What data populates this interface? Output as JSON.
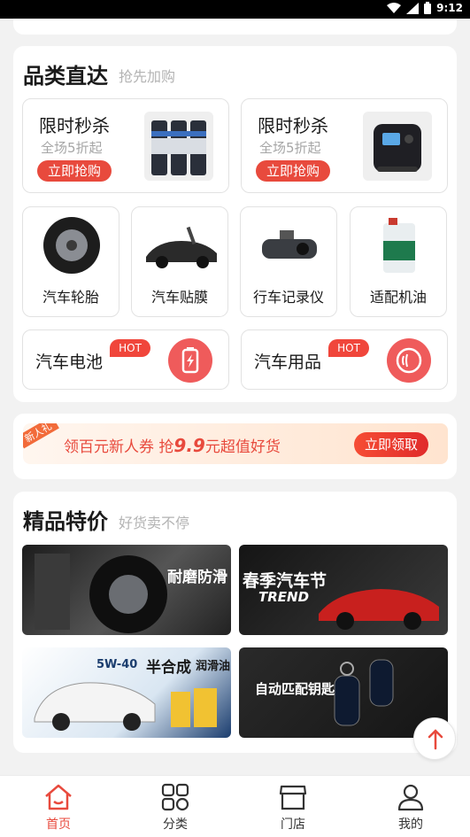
{
  "status_bar": {
    "time": "9:12"
  },
  "category_section": {
    "title": "品类直达",
    "subtitle": "抢先加购",
    "flash_sales": [
      {
        "title": "限时秒杀",
        "subtitle": "全场5折起",
        "button": "立即抢购",
        "image": "spray-cans"
      },
      {
        "title": "限时秒杀",
        "subtitle": "全场5折起",
        "button": "立即抢购",
        "image": "air-pump"
      }
    ],
    "categories": [
      {
        "label": "汽车轮胎",
        "image": "tire"
      },
      {
        "label": "汽车贴膜",
        "image": "sports-car"
      },
      {
        "label": "行车记录仪",
        "image": "dashcam"
      },
      {
        "label": "适配机油",
        "image": "oil-bottle"
      }
    ],
    "featured": [
      {
        "label": "汽车电池",
        "badge": "HOT",
        "icon": "battery-icon"
      },
      {
        "label": "汽车用品",
        "badge": "HOT",
        "icon": "tire-icon"
      }
    ]
  },
  "coupon_banner": {
    "tag": "新人礼",
    "text_prefix": "领百元新人券 抢",
    "text_price": "9.9",
    "text_suffix": "元超值好货",
    "button": "立即领取"
  },
  "premium_section": {
    "title": "精品特价",
    "subtitle": "好货卖不停",
    "promos": [
      {
        "headline": "耐磨防滑",
        "theme": "tire"
      },
      {
        "headline": "春季汽车节",
        "sub": "TREND",
        "theme": "red-car"
      },
      {
        "headline": "半合成",
        "sub": "润滑油",
        "top": "5W-40",
        "theme": "suv-oil"
      },
      {
        "headline": "自动匹配钥匙",
        "theme": "key"
      }
    ]
  },
  "tab_bar": {
    "tabs": [
      {
        "label": "首页",
        "icon": "home-icon",
        "active": true
      },
      {
        "label": "分类",
        "icon": "grid-icon",
        "active": false
      },
      {
        "label": "门店",
        "icon": "store-icon",
        "active": false
      },
      {
        "label": "我的",
        "icon": "user-icon",
        "active": false
      }
    ]
  },
  "colors": {
    "accent": "#e84a3d",
    "background": "#f2f2f2"
  }
}
